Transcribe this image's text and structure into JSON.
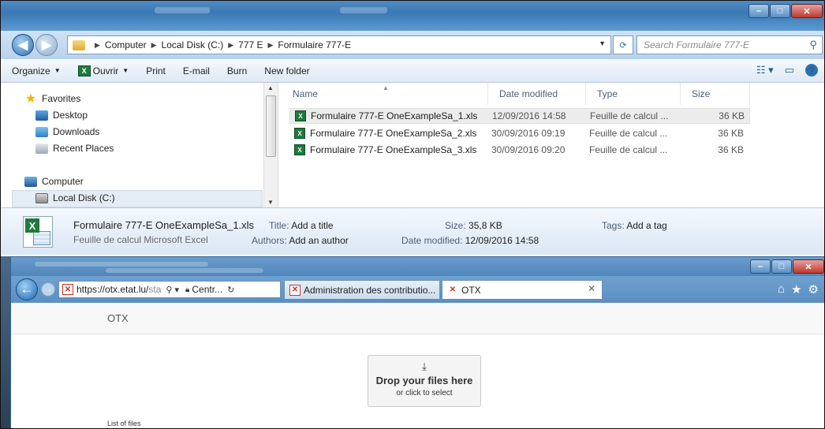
{
  "explorer": {
    "address": {
      "crumbs": [
        "Computer",
        "Local Disk (C:)",
        "777 E",
        "Formulaire 777-E"
      ]
    },
    "search_placeholder": "Search Formulaire 777-E",
    "toolbar": {
      "organize": "Organize",
      "open": "Ouvrir",
      "print": "Print",
      "email": "E-mail",
      "burn": "Burn",
      "new_folder": "New folder"
    },
    "nav": {
      "favorites": "Favorites",
      "desktop": "Desktop",
      "downloads": "Downloads",
      "recent_places": "Recent Places",
      "computer": "Computer",
      "local_disk": "Local Disk (C:)"
    },
    "columns": {
      "name": "Name",
      "date_modified": "Date modified",
      "type": "Type",
      "size": "Size"
    },
    "files": [
      {
        "name": "Formulaire 777-E OneExampleSa_1.xls",
        "date": "12/09/2016 14:58",
        "type": "Feuille de calcul ...",
        "size": "36 KB"
      },
      {
        "name": "Formulaire 777-E OneExampleSa_2.xls",
        "date": "30/09/2016 09:19",
        "type": "Feuille de calcul ...",
        "size": "36 KB"
      },
      {
        "name": "Formulaire 777-E OneExampleSa_3.xls",
        "date": "30/09/2016 09:20",
        "type": "Feuille de calcul ...",
        "size": "36 KB"
      }
    ],
    "details": {
      "filename": "Formulaire 777-E OneExampleSa_1.xls",
      "filetype": "Feuille de calcul Microsoft Excel",
      "title_label": "Title:",
      "title_value": "Add a title",
      "authors_label": "Authors:",
      "authors_value": "Add an author",
      "size_label": "Size:",
      "size_value": "35,8 KB",
      "date_label": "Date modified:",
      "date_value": "12/09/2016 14:58",
      "tags_label": "Tags:",
      "tags_value": "Add a tag"
    }
  },
  "browser": {
    "url_host": "https://otx.etat.lu/",
    "url_rest": "sta",
    "cert_label": "Centr...",
    "tabs": [
      {
        "label": "Administration des contributio..."
      },
      {
        "label": "OTX"
      }
    ],
    "page": {
      "brand": "OTX",
      "drop_title": "Drop your files here",
      "drop_sub": "or click to select",
      "list_of_files": "List of files"
    }
  },
  "colors": {
    "title_bar": "#4f8cc4",
    "excel_green": "#1f7a3d",
    "ie_chrome": "#5b8fc2"
  }
}
